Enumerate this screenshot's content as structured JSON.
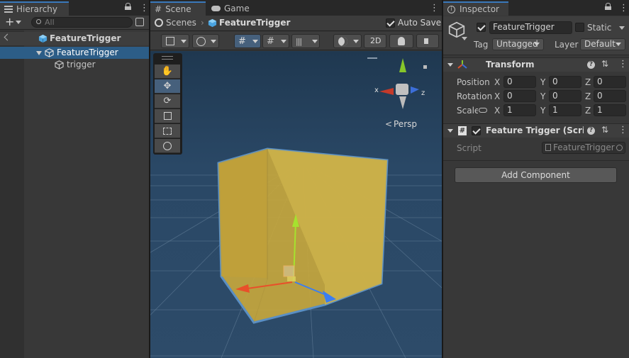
{
  "hierarchy": {
    "tab_label": "Hierarchy",
    "search_placeholder": "All",
    "scene_name": "FeatureTrigger",
    "items": [
      {
        "label": "FeatureTrigger"
      },
      {
        "label": "trigger"
      }
    ]
  },
  "scene_view": {
    "tabs": [
      {
        "label": "Scene"
      },
      {
        "label": "Game"
      }
    ],
    "breadcrumb": {
      "root": "Scenes",
      "current": "FeatureTrigger"
    },
    "auto_save_label": "Auto Save",
    "auto_save_checked": true,
    "mode_2d_label": "2D",
    "persp_label": "Persp",
    "gizmo_axes": {
      "x": "x",
      "z": "z"
    }
  },
  "inspector": {
    "tab_label": "Inspector",
    "object_name": "FeatureTrigger",
    "active_checked": true,
    "static_label": "Static",
    "tag_label": "Tag",
    "tag_value": "Untagged",
    "layer_label": "Layer",
    "layer_value": "Default",
    "transform": {
      "title": "Transform",
      "rows": [
        {
          "label": "Position",
          "x": "0",
          "y": "0",
          "z": "0"
        },
        {
          "label": "Rotation",
          "x": "0",
          "y": "0",
          "z": "0"
        },
        {
          "label": "Scale",
          "x": "1",
          "y": "1",
          "z": "1"
        }
      ],
      "axis_x": "X",
      "axis_y": "Y",
      "axis_z": "Z"
    },
    "component": {
      "title": "Feature Trigger (Script",
      "script_label": "Script",
      "script_value": "FeatureTrigger"
    },
    "add_component_label": "Add Component"
  },
  "colors": {
    "accent": "#3a79bb",
    "selection": "#2c5d87",
    "trigger_volume": "#c9a93c",
    "scene_bg": "#26405c"
  }
}
